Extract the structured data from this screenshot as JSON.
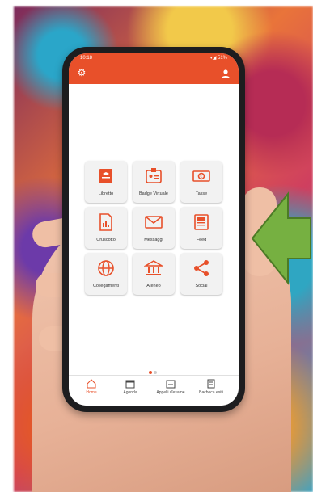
{
  "status_bar": {
    "time": "10:18",
    "indicators": "▾◢ 51%"
  },
  "header": {
    "settings_icon": "gear-icon",
    "profile_icon": "user-icon"
  },
  "tiles": [
    {
      "label": "Libretto",
      "icon": "libretto-icon"
    },
    {
      "label": "Badge Virtuale",
      "icon": "badge-icon"
    },
    {
      "label": "Tasse",
      "icon": "tasse-icon"
    },
    {
      "label": "Cruscotto",
      "icon": "cruscotto-icon"
    },
    {
      "label": "Messaggi",
      "icon": "messaggi-icon"
    },
    {
      "label": "Feed",
      "icon": "feed-icon"
    },
    {
      "label": "Collegamenti",
      "icon": "collegamenti-icon"
    },
    {
      "label": "Ateneo",
      "icon": "ateneo-icon"
    },
    {
      "label": "Social",
      "icon": "social-icon"
    }
  ],
  "pager": {
    "active_index": 0,
    "count": 2
  },
  "tabbar": [
    {
      "label": "Home",
      "icon": "home-icon",
      "active": true
    },
    {
      "label": "Agenda",
      "icon": "agenda-icon",
      "active": false
    },
    {
      "label": "Appelli d'esame",
      "icon": "appelli-icon",
      "active": false
    },
    {
      "label": "Bacheca esiti",
      "icon": "bacheca-icon",
      "active": false
    }
  ],
  "colors": {
    "accent": "#e8502a",
    "arrow": "#76b041"
  }
}
